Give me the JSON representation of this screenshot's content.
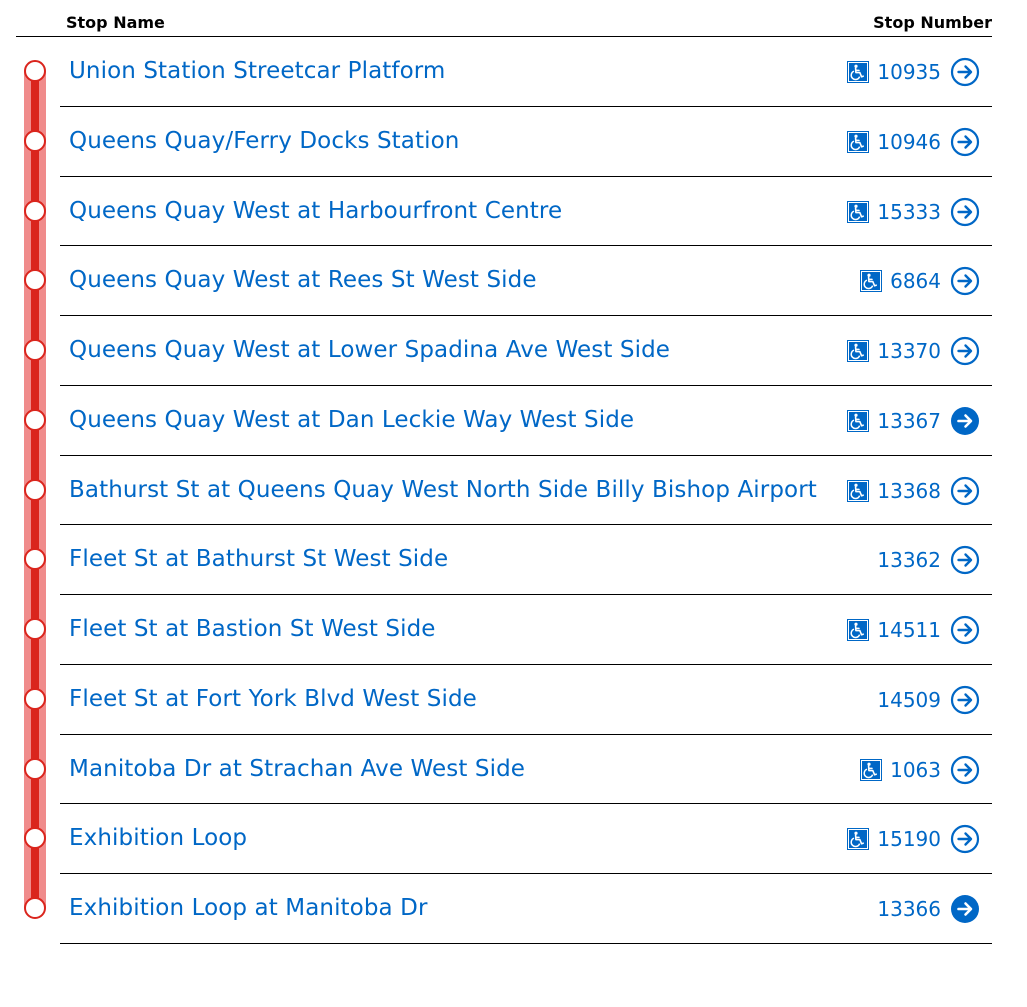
{
  "header": {
    "stop_name_label": "Stop Name",
    "stop_number_label": "Stop Number"
  },
  "colors": {
    "route_line": "#da251d",
    "route_line_light": "#f08b8b",
    "link": "#0067c6"
  },
  "stops": [
    {
      "name": "Union Station Streetcar Platform",
      "number": "10935",
      "accessible": true,
      "selected": false
    },
    {
      "name": "Queens Quay/Ferry Docks Station",
      "number": "10946",
      "accessible": true,
      "selected": false
    },
    {
      "name": "Queens Quay West at Harbourfront Centre",
      "number": "15333",
      "accessible": true,
      "selected": false
    },
    {
      "name": "Queens Quay West at Rees St West Side",
      "number": "6864",
      "accessible": true,
      "selected": false
    },
    {
      "name": "Queens Quay West at Lower Spadina Ave West Side",
      "number": "13370",
      "accessible": true,
      "selected": false
    },
    {
      "name": "Queens Quay West at Dan Leckie Way West Side",
      "number": "13367",
      "accessible": true,
      "selected": true
    },
    {
      "name": "Bathurst St at Queens Quay West North Side Billy Bishop Airport",
      "number": "13368",
      "accessible": true,
      "selected": false
    },
    {
      "name": "Fleet St at Bathurst St West Side",
      "number": "13362",
      "accessible": false,
      "selected": false
    },
    {
      "name": "Fleet St at Bastion St West Side",
      "number": "14511",
      "accessible": true,
      "selected": false
    },
    {
      "name": "Fleet St at Fort York Blvd West Side",
      "number": "14509",
      "accessible": false,
      "selected": false
    },
    {
      "name": "Manitoba Dr at Strachan Ave West Side",
      "number": "1063",
      "accessible": true,
      "selected": false
    },
    {
      "name": "Exhibition Loop",
      "number": "15190",
      "accessible": true,
      "selected": false
    },
    {
      "name": "Exhibition Loop at Manitoba Dr",
      "number": "13366",
      "accessible": false,
      "selected": true
    }
  ],
  "icons": {
    "accessible": "wheelchair-accessible-icon",
    "arrow": "arrow-circle-right-icon"
  }
}
